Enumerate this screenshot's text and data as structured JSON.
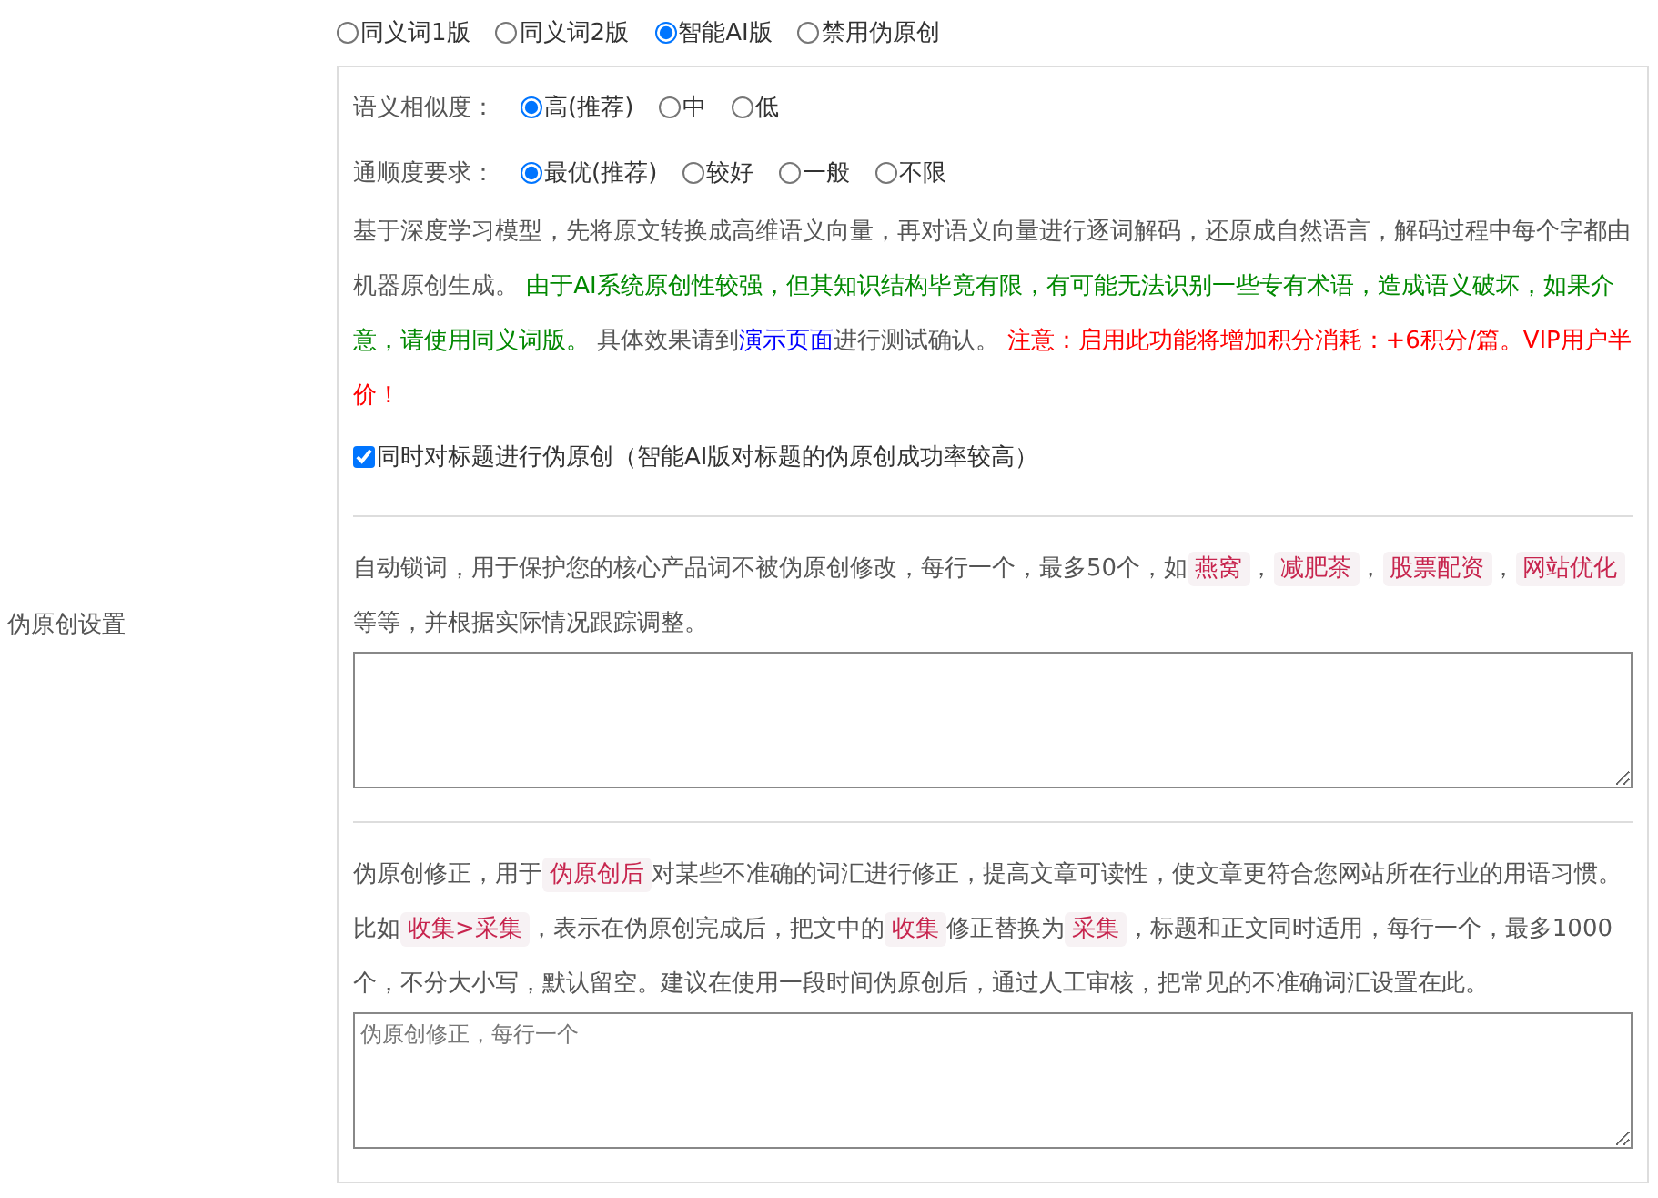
{
  "mode_options": [
    {
      "label": "同义词1版",
      "selected": false
    },
    {
      "label": "同义词2版",
      "selected": false
    },
    {
      "label": "智能AI版",
      "selected": true
    },
    {
      "label": "禁用伪原创",
      "selected": false
    }
  ],
  "row_label": "伪原创设置",
  "similarity": {
    "label": "语义相似度：",
    "options": [
      {
        "label": "高(推荐)",
        "selected": true
      },
      {
        "label": "中",
        "selected": false
      },
      {
        "label": "低",
        "selected": false
      }
    ]
  },
  "fluency": {
    "label": "通顺度要求：",
    "options": [
      {
        "label": "最优(推荐)",
        "selected": true
      },
      {
        "label": "较好",
        "selected": false
      },
      {
        "label": "一般",
        "selected": false
      },
      {
        "label": "不限",
        "selected": false
      }
    ]
  },
  "ai_description": [
    {
      "kind": "plain",
      "text": "基于深度学习模型，先将原文转换成高维语义向量，再对语义向量进行逐词解码，还原成自然语言，解码过程中每个字都由机器原创生成。 "
    },
    {
      "kind": "green",
      "text": "由于AI系统原创性较强，但其知识结构毕竟有限，有可能无法识别一些专有术语，造成语义破坏，如果介意，请使用同义词版。"
    },
    {
      "kind": "plain",
      "text": " 具体效果请到"
    },
    {
      "kind": "link",
      "text": "演示页面"
    },
    {
      "kind": "plain",
      "text": "进行测试确认。 "
    },
    {
      "kind": "red",
      "text": "注意：启用此功能将增加积分消耗：+6积分/篇。VIP用户半价！"
    }
  ],
  "title_option": {
    "label": "同时对标题进行伪原创（智能AI版对标题的伪原创成功率较高）",
    "checked": true
  },
  "lock_description": [
    {
      "kind": "plain",
      "text": "自动锁词，用于保护您的核心产品词不被伪原创修改，每行一个，最多50个，如"
    },
    {
      "kind": "code",
      "text": "燕窝"
    },
    {
      "kind": "plain",
      "text": "，"
    },
    {
      "kind": "code",
      "text": "减肥茶"
    },
    {
      "kind": "plain",
      "text": "，"
    },
    {
      "kind": "code",
      "text": "股票配资"
    },
    {
      "kind": "plain",
      "text": "，"
    },
    {
      "kind": "code",
      "text": "网站优化"
    },
    {
      "kind": "plain",
      "text": " 等等，并根据实际情况跟踪调整。"
    }
  ],
  "correction_description": [
    {
      "kind": "plain",
      "text": "伪原创修正，用于"
    },
    {
      "kind": "code",
      "text": "伪原创后"
    },
    {
      "kind": "plain",
      "text": "对某些不准确的词汇进行修正，提高文章可读性，使文章更符合您网站所在行业的用语习惯。比如"
    },
    {
      "kind": "code",
      "text": "收集>采集"
    },
    {
      "kind": "plain",
      "text": "，表示在伪原创完成后，把文中的"
    },
    {
      "kind": "code",
      "text": "收集"
    },
    {
      "kind": "plain",
      "text": "修正替换为"
    },
    {
      "kind": "code",
      "text": "采集"
    },
    {
      "kind": "plain",
      "text": "，标题和正文同时适用，每行一个，最多1000个，不分大小写，默认留空。建议在使用一段时间伪原创后，通过人工审核，把常见的不准确词汇设置在此。"
    }
  ],
  "correction_field": {
    "placeholder": "伪原创修正，每行一个"
  }
}
